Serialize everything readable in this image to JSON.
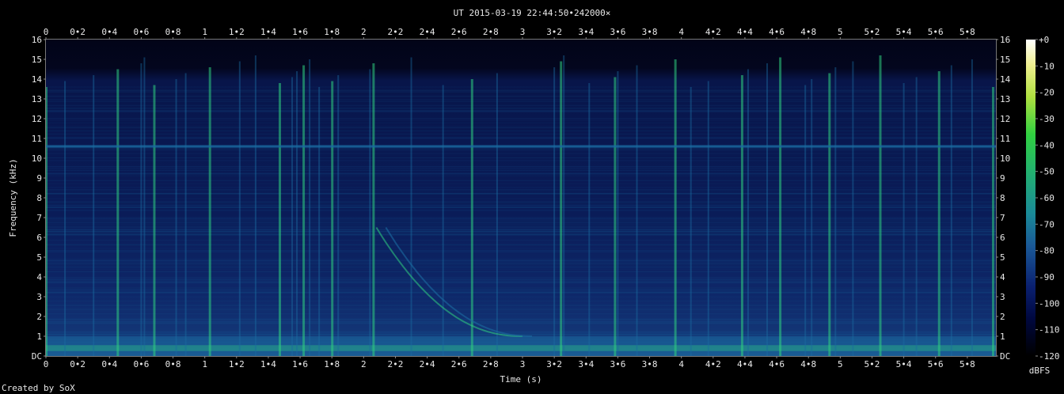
{
  "chart_data": {
    "type": "heatmap",
    "title": "UT 2015-03-19 22:44:50•242000×",
    "xlabel": "Time (s)",
    "ylabel": "Frequency (kHz)",
    "xlim": [
      0,
      5.98
    ],
    "ylim": [
      0,
      16
    ],
    "x_ticks": [
      "0",
      "0•2",
      "0•4",
      "0•6",
      "0•8",
      "1",
      "1•2",
      "1•4",
      "1•6",
      "1•8",
      "2",
      "2•2",
      "2•4",
      "2•6",
      "2•8",
      "3",
      "3•2",
      "3•4",
      "3•6",
      "3•8",
      "4",
      "4•2",
      "4•4",
      "4•6",
      "4•8",
      "5",
      "5•2",
      "5•4",
      "5•6",
      "5•8"
    ],
    "y_ticks": [
      "DC",
      "1",
      "2",
      "3",
      "4",
      "5",
      "6",
      "7",
      "8",
      "9",
      "10",
      "11",
      "12",
      "13",
      "14",
      "15",
      "16"
    ],
    "colorbar": {
      "label": "dBFS",
      "range": [
        -120,
        0
      ],
      "ticks": [
        "+0",
        "-10",
        "-20",
        "-30",
        "-40",
        "-50",
        "-60",
        "-70",
        "-80",
        "-90",
        "-100",
        "-110",
        "-120"
      ]
    },
    "features": {
      "background_level_dbfs": -95,
      "low_freq_band_khz": [
        0,
        1
      ],
      "constant_tone_khz": 10.6,
      "whistler_start_s": 2.08,
      "whistler_end_s": 3.0,
      "whistler_start_khz": 6.5,
      "whistler_end_khz": 1.0,
      "sferic_times_s": [
        0.0,
        0.12,
        0.3,
        0.45,
        0.6,
        0.62,
        0.68,
        0.82,
        0.88,
        1.03,
        1.22,
        1.32,
        1.47,
        1.55,
        1.58,
        1.62,
        1.66,
        1.72,
        1.8,
        1.84,
        2.04,
        2.06,
        2.3,
        2.5,
        2.68,
        2.84,
        3.2,
        3.24,
        3.26,
        3.42,
        3.58,
        3.6,
        3.72,
        3.96,
        4.06,
        4.17,
        4.38,
        4.42,
        4.54,
        4.62,
        4.78,
        4.82,
        4.93,
        4.97,
        5.08,
        5.25,
        5.4,
        5.48,
        5.62,
        5.7,
        5.83,
        5.96
      ]
    },
    "colors": {
      "background": "#000000",
      "low": "#081850",
      "mid": "#1a6aa0",
      "high": "#30d080",
      "peak": "#ffffa0"
    }
  },
  "footer": {
    "credit": "Created by SoX"
  }
}
